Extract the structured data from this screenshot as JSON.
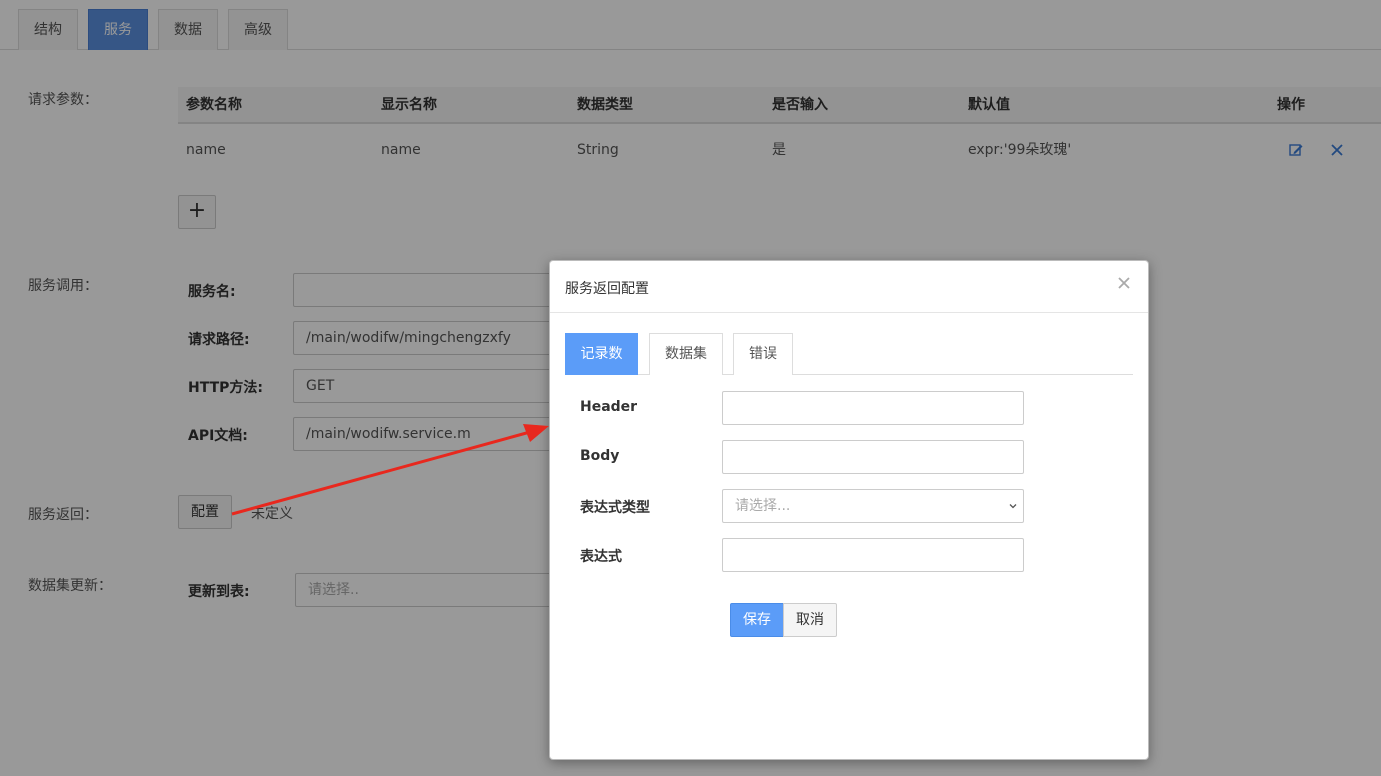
{
  "top_tabs": [
    {
      "label": "结构",
      "active": false
    },
    {
      "label": "服务",
      "active": true
    },
    {
      "label": "数据",
      "active": false
    },
    {
      "label": "高级",
      "active": false
    }
  ],
  "request_params": {
    "section_label": "请求参数：",
    "columns": [
      "参数名称",
      "显示名称",
      "数据类型",
      "是否输入",
      "默认值",
      "操作"
    ],
    "rows": [
      {
        "param_name": "name",
        "display_name": "name",
        "data_type": "String",
        "is_input": "是",
        "default_value": "expr:'99朵玫瑰'",
        "actions": [
          "edit-icon",
          "delete-icon"
        ]
      }
    ],
    "add_button": "+"
  },
  "service_call": {
    "section_label": "服务调用：",
    "fields": [
      {
        "label": "服务名:",
        "value": "",
        "placeholder": ""
      },
      {
        "label": "请求路径:",
        "value": "/main/wodifw/mingchengzxfy"
      },
      {
        "label": "HTTP方法:",
        "value": "GET"
      },
      {
        "label": "API文档:",
        "value": "/main/wodifw.service.m"
      }
    ]
  },
  "service_return": {
    "section_label": "服务返回：",
    "config_button": "配置",
    "status_text": "未定义"
  },
  "dataset_update": {
    "section_label": "数据集更新：",
    "field_label": "更新到表:",
    "placeholder": "请选择.."
  },
  "modal": {
    "title": "服务返回配置",
    "close_icon": "close-icon",
    "tabs": [
      {
        "label": "记录数",
        "active": true
      },
      {
        "label": "数据集",
        "active": false
      },
      {
        "label": "错误",
        "active": false
      }
    ],
    "fields": [
      {
        "label": "Header",
        "value": ""
      },
      {
        "label": "Body",
        "value": ""
      },
      {
        "label": "表达式类型",
        "placeholder": "请选择..."
      },
      {
        "label": "表达式",
        "value": ""
      }
    ],
    "save_button": "保存",
    "cancel_button": "取消"
  },
  "colors": {
    "primary": "#5b9cf8",
    "active_tab": "#5b8fe0",
    "annotation_arrow": "#e8281e",
    "action_icon": "#3a7bd5"
  }
}
